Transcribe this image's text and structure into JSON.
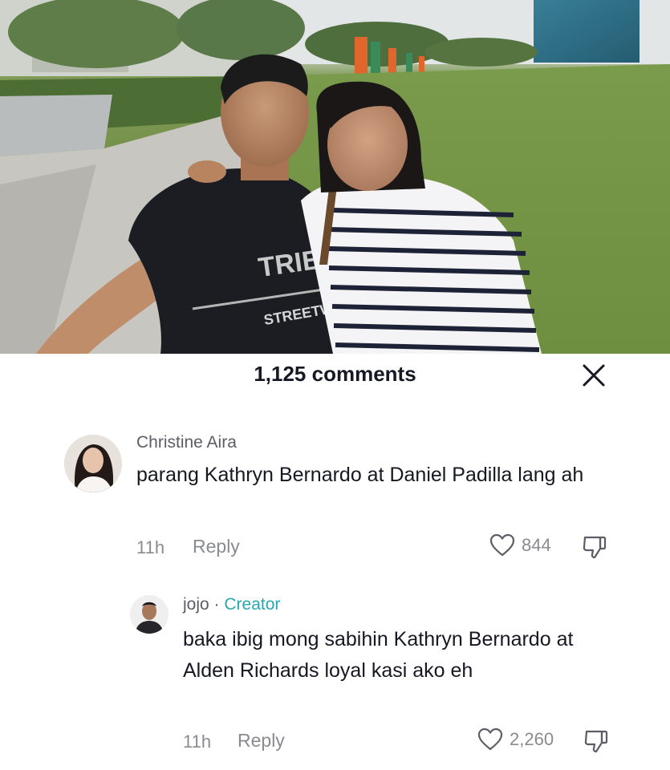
{
  "sheet": {
    "comment_count": "1,125 comments",
    "close_icon": "close-icon"
  },
  "comments": [
    {
      "username": "Christine Aira",
      "text": "parang Kathryn Bernardo at Daniel Padilla lang ah",
      "time": "11h",
      "reply_label": "Reply",
      "likes": "844",
      "is_creator": false
    },
    {
      "username": "jojo",
      "badge_separator": "·",
      "badge": "Creator",
      "text": "baka ibig mong sabihin Kathryn Bernardo at Alden Richards loyal kasi ako eh",
      "time": "11h",
      "reply_label": "Reply",
      "likes": "2,260",
      "is_creator": true
    }
  ],
  "colors": {
    "creator_badge": "#2aa6b0",
    "secondary_text": "#8a8b91"
  }
}
